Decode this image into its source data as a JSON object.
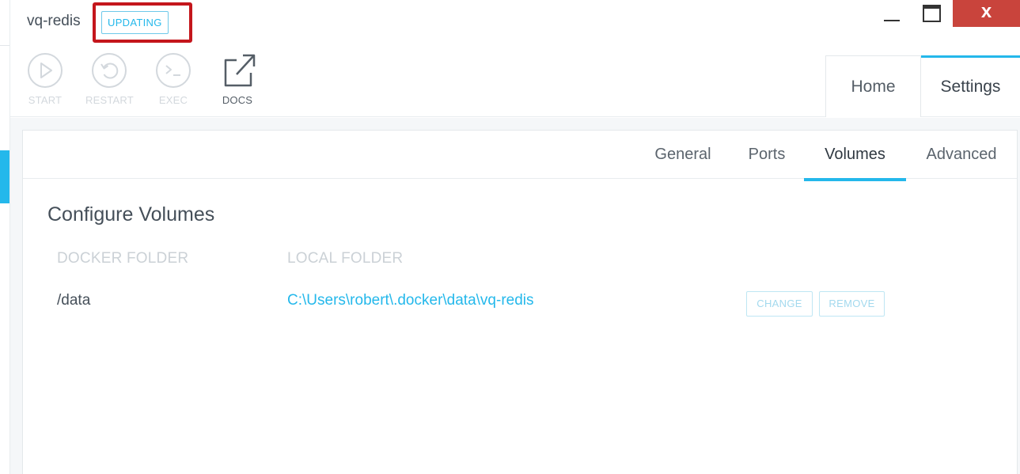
{
  "container": {
    "name": "vq-redis",
    "status": "UPDATING"
  },
  "actions": [
    {
      "label": "START",
      "icon": "play-circle-icon",
      "enabled": false
    },
    {
      "label": "RESTART",
      "icon": "restart-circle-icon",
      "enabled": false
    },
    {
      "label": "EXEC",
      "icon": "terminal-circle-icon",
      "enabled": false
    },
    {
      "label": "DOCS",
      "icon": "external-link-icon",
      "enabled": true
    }
  ],
  "window_controls": {
    "close_glyph": "x"
  },
  "main_tabs": {
    "home": "Home",
    "settings": "Settings",
    "active": "Settings"
  },
  "settings_tabs": {
    "items": [
      "General",
      "Ports",
      "Volumes",
      "Advanced"
    ],
    "active": "Volumes"
  },
  "volumes": {
    "title": "Configure Volumes",
    "headers": {
      "docker": "DOCKER FOLDER",
      "local": "LOCAL FOLDER"
    },
    "rows": [
      {
        "docker_folder": "/data",
        "local_folder": "C:\\Users\\robert\\.docker\\data\\vq-redis",
        "change_label": "CHANGE",
        "remove_label": "REMOVE"
      }
    ]
  },
  "colors": {
    "accent": "#24b8eb",
    "highlight": "#c4161c",
    "close_button": "#c9443c",
    "disabled_text": "#d3d8dd"
  }
}
